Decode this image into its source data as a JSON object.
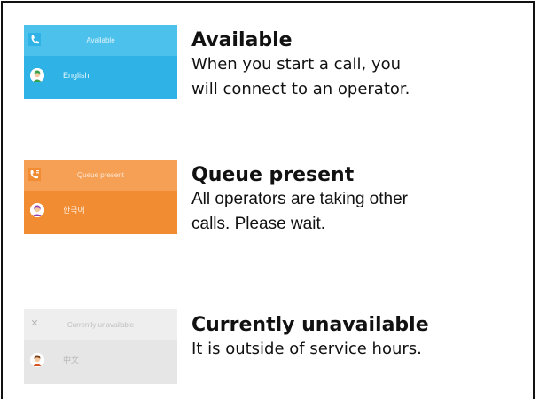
{
  "statuses": [
    {
      "theme": "blue",
      "header_icon": "phone-icon",
      "header_label": "Available",
      "language": "English",
      "title": "Available",
      "line1": "When you start a call, you",
      "line2": "will connect to an operator."
    },
    {
      "theme": "orange",
      "header_icon": "phone-queue-icon",
      "header_label": "Queue present",
      "language": "한국어",
      "title": "Queue present",
      "line1": "All operators are taking other",
      "line2": "calls. Please wait."
    },
    {
      "theme": "grey",
      "header_icon": "close-icon",
      "header_label": "Currently unavailable",
      "language": "中文",
      "title": "Currently unavailable",
      "line1": "It is outside of service hours.",
      "line2": ""
    }
  ],
  "colors": {
    "available": "#2fb3e6",
    "queue": "#f28c33",
    "unavailable": "#e6e6e6"
  }
}
